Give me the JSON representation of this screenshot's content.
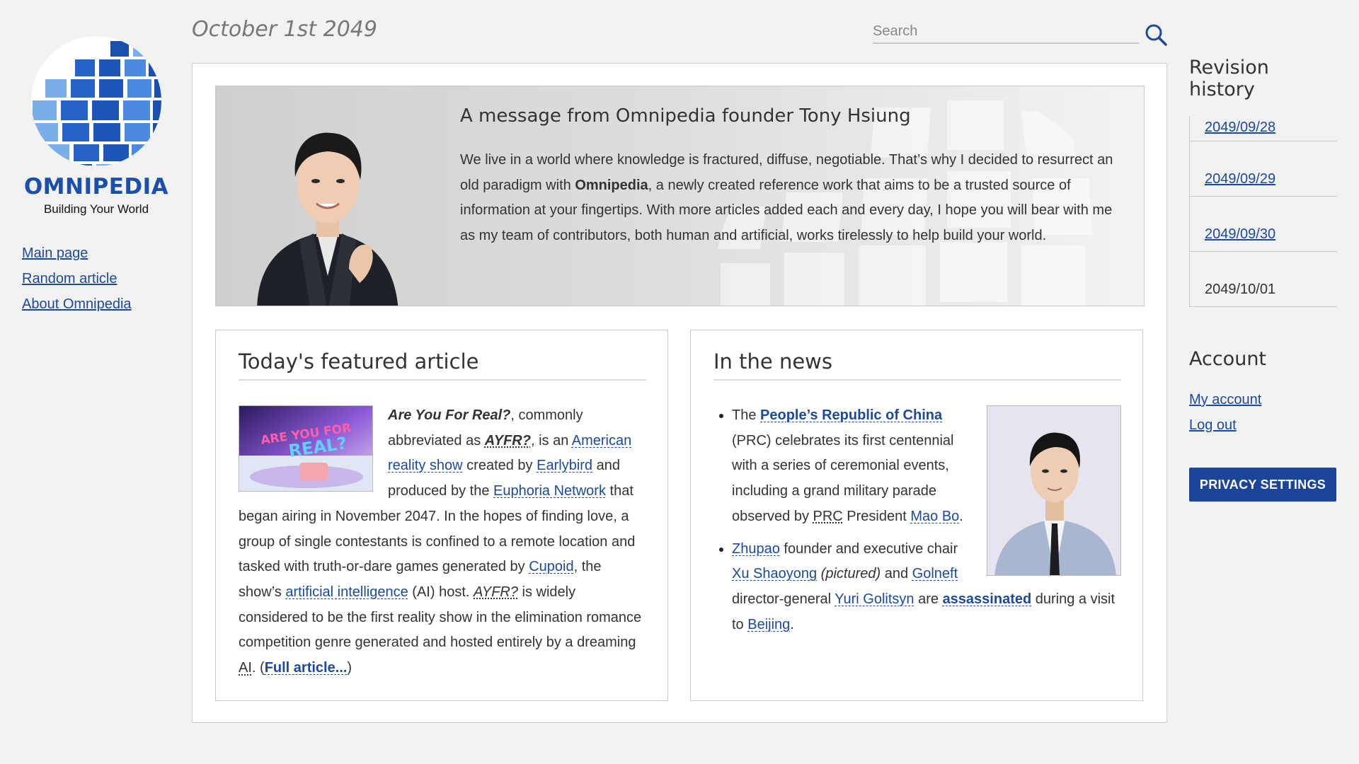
{
  "header": {
    "date": "October 1st 2049",
    "search_placeholder": "Search"
  },
  "sidebar": {
    "brand": "OMNIPEDIA",
    "tagline": "Building Your World",
    "nav": [
      {
        "label": "Main page"
      },
      {
        "label": "Random article"
      },
      {
        "label": "About Omnipedia"
      }
    ]
  },
  "message": {
    "title": "A message from Omnipedia founder Tony Hsiung",
    "body_1": "We live in a world where knowledge is fractured, diffuse, negotiable. That’s why I decided to resurrect an old paradigm with ",
    "body_bold": "Omnipedia",
    "body_2": ", a newly created reference work that aims to be a trusted source of information at your fingertips. With more articles added each and every day, I hope you will bear with me as my team of contributors, both human and artificial, works tirelessly to help build your world."
  },
  "featured": {
    "heading": "Today's featured article",
    "image_text_1": "ARE YOU FOR",
    "image_text_2": "REAL?",
    "t_title": "Are You For Real?",
    "t1": ", commonly abbreviated as ",
    "t_abbr": "AYFR?",
    "t2": ", is an ",
    "l_american": "American",
    "l_reality": "reality show",
    "t3": " created by ",
    "l_earlybird": "Earlybird",
    "t4": " and produced by the ",
    "l_euphoria": "Euphoria Network",
    "t5": " that began airing in November 2047. In the hopes of finding love, a group of single contestants is confined to a remote location and tasked with truth-or-dare games generated by ",
    "l_cupoid": "Cupoid",
    "t6": ", the show’s ",
    "l_ai": "artificial intelligence",
    "t7": " (AI) host. ",
    "t_abbr2": "AYFR?",
    "t8": " is widely considered to be the first reality show in the elimination romance competition genre generated and hosted entirely by a dreaming ",
    "t_ai_abbr": "AI",
    "t9": ". (",
    "l_full": "Full article...",
    "t10": ")"
  },
  "news": {
    "heading": "In the news",
    "item1": {
      "t1": "The ",
      "l_prc_full": "People’s Republic of China",
      "t2": " (PRC) celebrates its first centennial with a series of ceremonial events, including a grand military parade observed by ",
      "abbr_prc": "PRC",
      "t3": " President ",
      "l_mao": "Mao Bo",
      "t4": "."
    },
    "item2": {
      "l_zhupao": "Zhupao",
      "t1": " founder and executive chair ",
      "l_xu": "Xu Shaoyong",
      "t_pictured": "(pictured)",
      "t2": " and ",
      "l_golneft": "Golneft",
      "t3": " director-general ",
      "l_yuri": "Yuri Golitsyn",
      "t4": " are ",
      "l_assassinated": "assassinated",
      "t5": " during a visit to ",
      "l_beijing": "Beijing",
      "t6": "."
    }
  },
  "right": {
    "revision_heading": "Revision history",
    "revisions": [
      {
        "label": "2049/09/28"
      },
      {
        "label": "2049/09/29"
      },
      {
        "label": "2049/09/30"
      },
      {
        "label": "2049/10/01"
      }
    ],
    "account_heading": "Account",
    "account_links": [
      {
        "label": "My account"
      },
      {
        "label": "Log out"
      }
    ],
    "privacy_button": "PRIVACY SETTINGS"
  },
  "colors": {
    "link": "#1a4a9c",
    "brand": "#1a4fae",
    "button_bg": "#1a4599",
    "background": "#f2f2f2"
  },
  "icons": [
    "globe-logo-icon",
    "search-icon"
  ]
}
